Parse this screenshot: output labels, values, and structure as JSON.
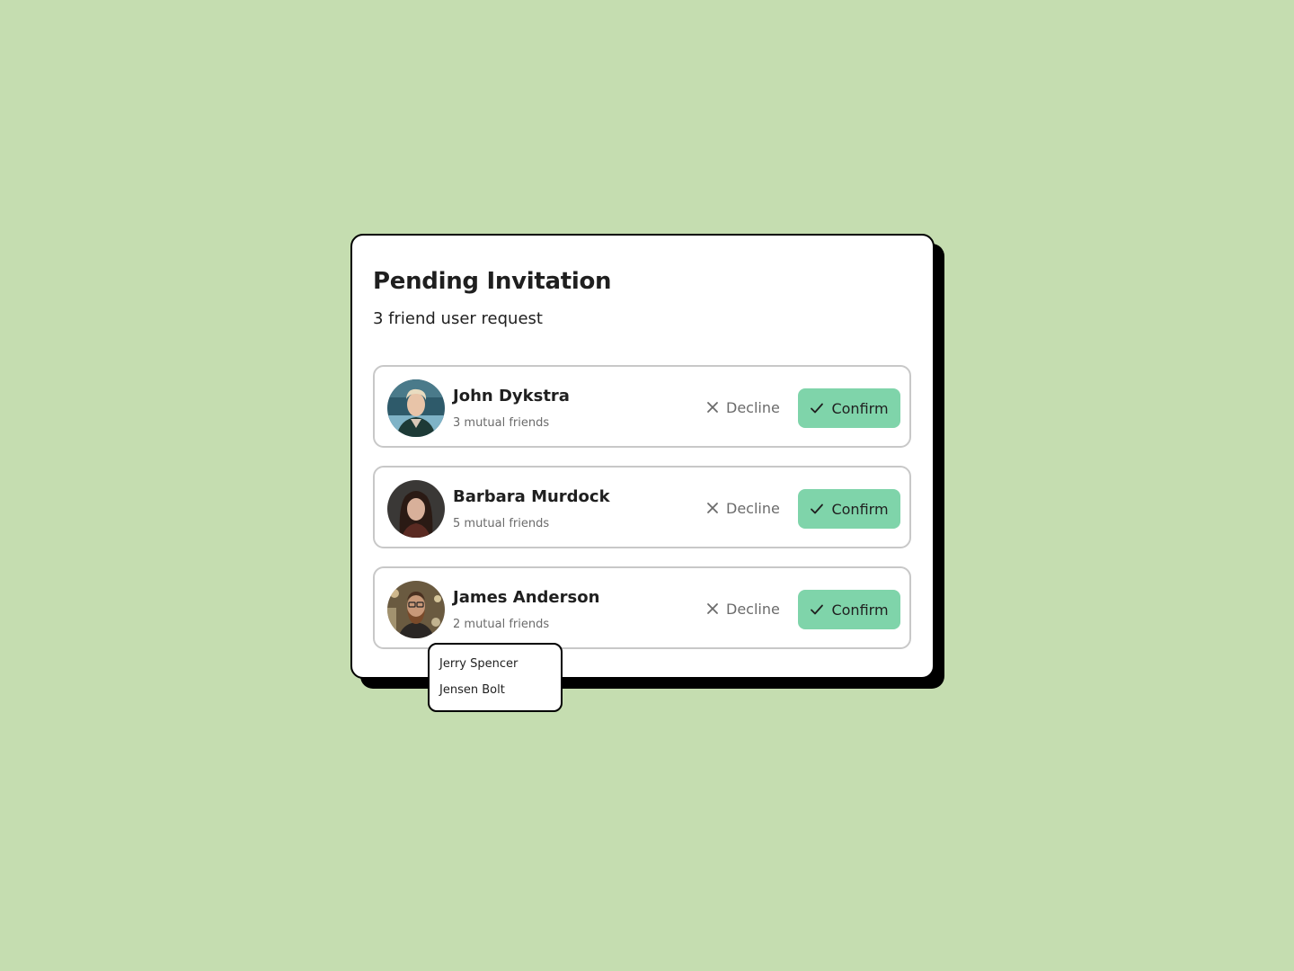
{
  "card": {
    "title": "Pending Invitation",
    "subtitle": "3 friend user request"
  },
  "requests": [
    {
      "name": "John Dykstra",
      "mutual": "3 mutual friends",
      "decline_label": "Decline",
      "confirm_label": "Confirm"
    },
    {
      "name": "Barbara Murdock",
      "mutual": "5 mutual friends",
      "decline_label": "Decline",
      "confirm_label": "Confirm"
    },
    {
      "name": "James Anderson",
      "mutual": "2 mutual friends",
      "decline_label": "Decline",
      "confirm_label": "Confirm"
    }
  ],
  "mutual_popup": {
    "items": [
      "Jerry Spencer",
      "Jensen Bolt"
    ]
  },
  "colors": {
    "background": "#c5ddb0",
    "confirm": "#7fd4aa",
    "text": "#1f1f1f",
    "muted": "#6b6b6b"
  },
  "icons": {
    "decline": "close-icon",
    "confirm": "check-icon"
  }
}
